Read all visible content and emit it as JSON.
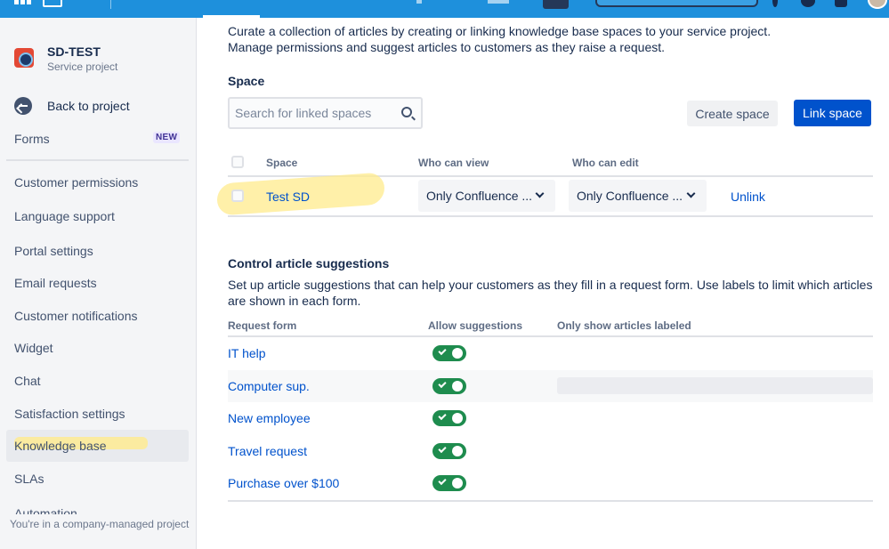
{
  "colors": {
    "primary": "#0052cc",
    "topbar": "#1e90dc",
    "toggle_on": "#1e8c4e",
    "highlight": "#ffeb8c"
  },
  "project": {
    "name": "SD-TEST",
    "type": "Service project"
  },
  "sidebar": {
    "back_label": "Back to project",
    "forms_label": "Forms",
    "new_badge": "NEW",
    "items": [
      {
        "label": "Customer permissions"
      },
      {
        "label": "Language support"
      },
      {
        "label": "Portal settings"
      },
      {
        "label": "Email requests"
      },
      {
        "label": "Customer notifications"
      },
      {
        "label": "Widget"
      },
      {
        "label": "Chat"
      },
      {
        "label": "Satisfaction settings"
      },
      {
        "label": "Knowledge base",
        "selected": true
      },
      {
        "label": "SLAs"
      },
      {
        "label": "Automation"
      }
    ],
    "footer": "You're in a company-managed project"
  },
  "intro": {
    "line1": "Curate a collection of articles by creating or linking knowledge base spaces to your service project.",
    "line2": "Manage permissions and suggest articles to customers as they raise a request."
  },
  "space_section": {
    "heading": "Space",
    "search_placeholder": "Search for linked spaces",
    "create_button": "Create space",
    "link_button": "Link space",
    "columns": {
      "space": "Space",
      "view": "Who can view",
      "edit": "Who can edit"
    },
    "rows": [
      {
        "space": "Test SD",
        "view": "Only Confluence ...",
        "edit": "Only Confluence ...",
        "action": "Unlink"
      }
    ]
  },
  "control_section": {
    "heading": "Control article suggestions",
    "description": "Set up article suggestions that can help your customers as they fill in a request form. Use labels to limit which articles are shown in each form.",
    "columns": {
      "form": "Request form",
      "allow": "Allow suggestions",
      "labels": "Only show articles labeled"
    },
    "rows": [
      {
        "form": "IT help",
        "allow": true
      },
      {
        "form": "Computer sup.",
        "allow": true
      },
      {
        "form": "New employee",
        "allow": true
      },
      {
        "form": "Travel request",
        "allow": true
      },
      {
        "form": "Purchase over $100",
        "allow": true
      }
    ]
  }
}
